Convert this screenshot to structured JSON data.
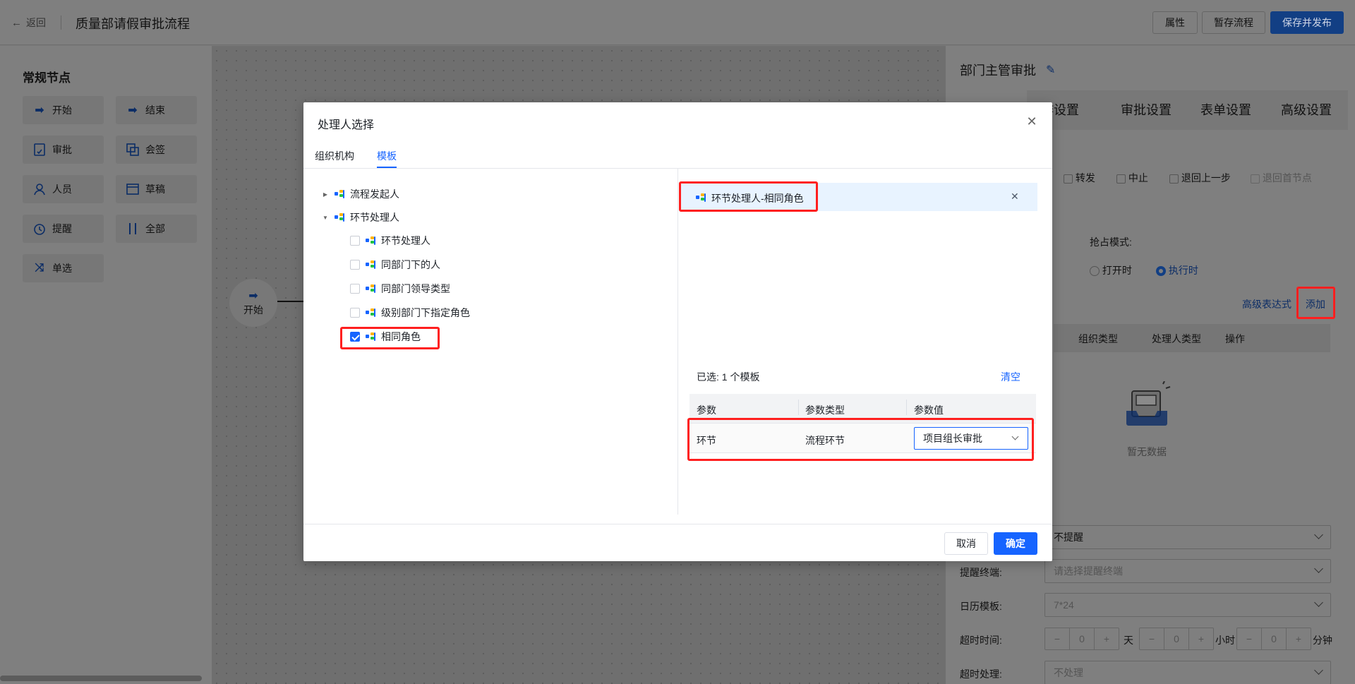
{
  "header": {
    "back_label": "返回",
    "title": "质量部请假审批流程",
    "btn_properties": "属性",
    "btn_save_draft": "暂存流程",
    "btn_save_publish": "保存并发布"
  },
  "left_panel": {
    "title": "常规节点",
    "nodes": [
      {
        "label": "开始",
        "icon": "arrow-right-icon"
      },
      {
        "label": "结束",
        "icon": "arrow-end-icon"
      },
      {
        "label": "审批",
        "icon": "approval-doc-icon"
      },
      {
        "label": "会签",
        "icon": "countersign-icon"
      },
      {
        "label": "人员",
        "icon": "person-icon"
      },
      {
        "label": "草稿",
        "icon": "draft-icon"
      },
      {
        "label": "提醒",
        "icon": "alarm-clock-icon"
      },
      {
        "label": "全部",
        "icon": "parallel-icon"
      },
      {
        "label": "单选",
        "icon": "shuffle-icon"
      }
    ]
  },
  "canvas": {
    "start_node_label": "开始"
  },
  "right_panel": {
    "title": "部门主管审批",
    "tabs": [
      "作设置",
      "审批设置",
      "表单设置",
      "高级设置"
    ],
    "actions": [
      "转发",
      "中止",
      "退回上一步",
      "退回首节点"
    ],
    "preempt_label": "抢占模式:",
    "radio_open": "打开时",
    "radio_exec": "执行时",
    "adv_expr": "高级表达式",
    "add_link": "添加",
    "table_headers": [
      "组织类型",
      "处理人类型",
      "操作"
    ],
    "empty_text": "暂无数据",
    "remind_value": "不提醒",
    "remind_terminal_label": "提醒终端:",
    "remind_terminal_placeholder": "请选择提醒终端",
    "calendar_label": "日历模板:",
    "calendar_value": "7*24",
    "timeout_label": "超时时间:",
    "timeout_days": "0",
    "unit_day": "天",
    "timeout_hours": "0",
    "unit_hour": "小时",
    "timeout_minutes": "0",
    "unit_minute": "分钟",
    "timeout_handle_label": "超时处理:",
    "timeout_handle_value": "不处理",
    "minus": "−",
    "plus": "+"
  },
  "modal": {
    "title": "处理人选择",
    "tabs": [
      "组织机构",
      "模板"
    ],
    "active_tab": "模板",
    "tree": {
      "root1": "流程发起人",
      "root2": "环节处理人",
      "children": [
        {
          "label": "环节处理人",
          "checked": false
        },
        {
          "label": "同部门下的人",
          "checked": false
        },
        {
          "label": "同部门领导类型",
          "checked": false
        },
        {
          "label": "级别部门下指定角色",
          "checked": false
        },
        {
          "label": "相同角色",
          "checked": true
        }
      ]
    },
    "selected_chip": "环节处理人-相同角色",
    "selected_count_text": "已选:  1 个模板",
    "clear_label": "清空",
    "param_table": {
      "headers": [
        "参数",
        "参数类型",
        "参数值"
      ],
      "row": {
        "param": "环节",
        "type": "流程环节",
        "value": "项目组长审批"
      }
    },
    "cancel_label": "取消",
    "confirm_label": "确定"
  },
  "colors": {
    "primary": "#1664ff",
    "highlight_box": "#ff1f1f",
    "overlay": "#7f7f7f"
  }
}
